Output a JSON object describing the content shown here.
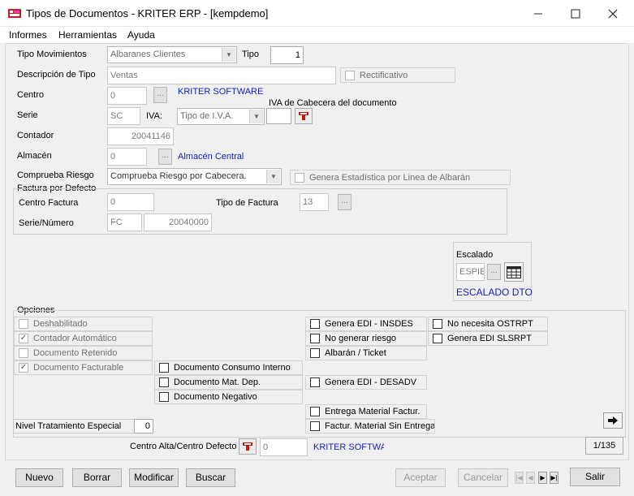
{
  "window": {
    "title": "Tipos de Documentos - KRITER ERP - [kempdemo]",
    "minimize_icon": "minimize-icon",
    "maximize_icon": "maximize-icon",
    "close_icon": "close-icon"
  },
  "menu": [
    "Informes",
    "Herramientas",
    "Ayuda"
  ],
  "form": {
    "tipo_movimientos_label": "Tipo Movimientos",
    "tipo_movimientos_value": "Albaranes Clientes",
    "tipo_label": "Tipo",
    "tipo_value": "1",
    "descripcion_label": "Descripción de Tipo",
    "descripcion_value": "Ventas",
    "rectificativo_label": "Rectificativo",
    "centro_label": "Centro",
    "centro_value": "0",
    "centro_name": "KRITER SOFTWARE",
    "iva_cabecera_label": "IVA de Cabecera del documento",
    "serie_label": "Serie",
    "serie_value": "SC",
    "iva_label": "IVA:",
    "iva_value": "Tipo de I.V.A.",
    "iva_cabecera_value": "",
    "contador_label": "Contador",
    "contador_value": "20041146",
    "almacen_label": "Almacén",
    "almacen_value": "0",
    "almacen_name": "Almacén Central",
    "comprueba_riesgo_label": "Comprueba Riesgo",
    "comprueba_riesgo_value": "Comprueba Riesgo por Cabecera.",
    "genera_estadistica_label": "Genera Estadística por Linea de Albarán",
    "dots_label": "..."
  },
  "factura": {
    "group_label": "Factura por Defecto",
    "centro_factura_label": "Centro Factura",
    "centro_factura_value": "0",
    "tipo_factura_label": "Tipo de Factura",
    "tipo_factura_value": "13",
    "serie_numero_label": "Serie/Número",
    "serie_value": "FC",
    "numero_value": "20040000"
  },
  "escalado": {
    "label": "Escalado",
    "value": "ESPIE",
    "name": "ESCALADO DTO"
  },
  "opciones": {
    "label": "Opciones",
    "col1": [
      {
        "label": "Deshabilitado",
        "checked": false
      },
      {
        "label": "Contador Automático",
        "checked": true
      },
      {
        "label": "Documento Retenido",
        "checked": false
      },
      {
        "label": "Documento Facturable",
        "checked": true
      }
    ],
    "col2": [
      {
        "label": "Documento Consumo Interno",
        "checked": false
      },
      {
        "label": "Documento Mat. Dep.",
        "checked": false
      },
      {
        "label": "Documento Negativo",
        "checked": false
      }
    ],
    "col3": [
      {
        "label": "Genera EDI - INSDES",
        "checked": false
      },
      {
        "label": "No generar riesgo",
        "checked": false
      },
      {
        "label": "Albarán / Ticket",
        "checked": false
      }
    ],
    "col3b": [
      {
        "label": "Genera EDI - DESADV",
        "checked": false
      }
    ],
    "col3c": [
      {
        "label": "Entrega Material Factur.",
        "checked": false
      },
      {
        "label": "Factur. Material Sin Entrega",
        "checked": false
      }
    ],
    "col4": [
      {
        "label": "No necesita OSTRPT",
        "checked": false
      },
      {
        "label": "Genera EDI SLSRPT",
        "checked": false
      }
    ],
    "nivel_label": "Nivel Tratamiento Especial",
    "nivel_value": "0"
  },
  "centro_alta": {
    "label": "Centro Alta/Centro Defecto",
    "value": "0",
    "name": "KRITER SOFTWA"
  },
  "record_counter": "1/135",
  "buttons": {
    "nuevo": "Nuevo",
    "borrar": "Borrar",
    "modificar": "Modificar",
    "buscar": "Buscar",
    "aceptar": "Aceptar",
    "cancelar": "Cancelar",
    "salir": "Salir"
  }
}
